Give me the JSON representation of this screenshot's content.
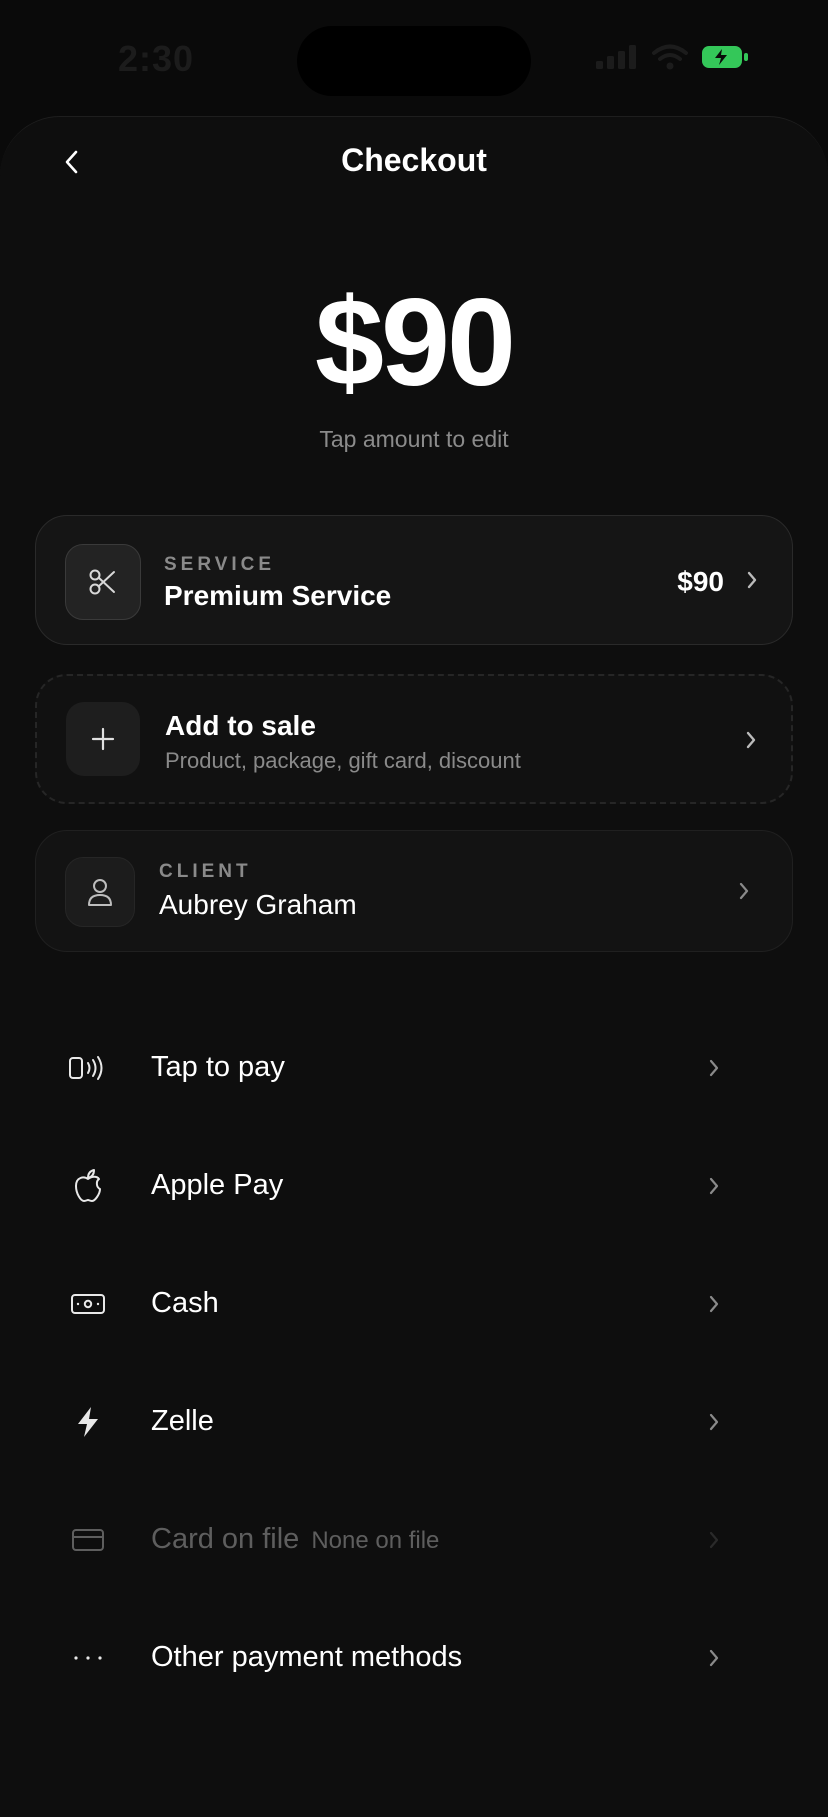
{
  "status": {
    "time": "2:30"
  },
  "header": {
    "title": "Checkout"
  },
  "amount": {
    "value": "$90",
    "hint": "Tap amount to edit"
  },
  "service": {
    "kicker": "SERVICE",
    "name": "Premium Service",
    "price": "$90",
    "icon": "scissors-icon"
  },
  "add_to_sale": {
    "title": "Add to sale",
    "subtitle": "Product, package, gift card, discount",
    "icon": "plus-icon"
  },
  "client": {
    "kicker": "CLIENT",
    "name": "Aubrey Graham",
    "icon": "person-icon"
  },
  "payment_methods": [
    {
      "label": "Tap to pay",
      "sub": "",
      "icon": "contactless-phone-icon",
      "enabled": true
    },
    {
      "label": "Apple Pay",
      "sub": "",
      "icon": "apple-icon",
      "enabled": true
    },
    {
      "label": "Cash",
      "sub": "",
      "icon": "cash-icon",
      "enabled": true
    },
    {
      "label": "Zelle",
      "sub": "",
      "icon": "bolt-icon",
      "enabled": true
    },
    {
      "label": "Card on file",
      "sub": "None on file",
      "icon": "card-icon",
      "enabled": false
    },
    {
      "label": "Other payment methods",
      "sub": "",
      "icon": "more-icon",
      "enabled": true
    }
  ],
  "colors": {
    "background": "#0a0a0a",
    "sheet": "#0e0e0e",
    "battery": "#34c759",
    "muted_text": "#8a8a8a"
  }
}
